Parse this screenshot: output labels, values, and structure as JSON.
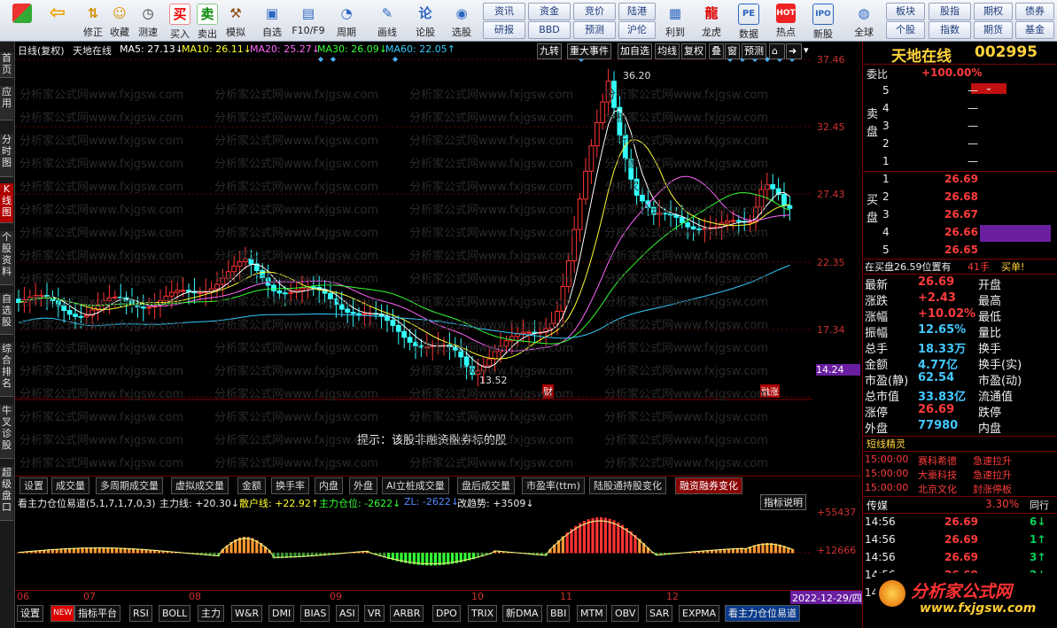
{
  "toolbar": {
    "buttons": [
      {
        "name": "home",
        "label": ""
      },
      {
        "name": "back",
        "label": ""
      },
      {
        "name": "modify",
        "label": "修正"
      },
      {
        "name": "favorite",
        "label": "收藏"
      },
      {
        "name": "speedtest",
        "label": "测速"
      },
      {
        "name": "buy",
        "label": "买入"
      },
      {
        "name": "sell",
        "label": "卖出"
      },
      {
        "name": "simulate",
        "label": "模拟"
      },
      {
        "name": "self-select",
        "label": "自选"
      },
      {
        "name": "f10",
        "label": "F10/F9"
      },
      {
        "name": "cycle",
        "label": "周期"
      },
      {
        "name": "draw",
        "label": "画线"
      },
      {
        "name": "stock-eval",
        "label": "论股"
      },
      {
        "name": "pick",
        "label": "选股"
      },
      {
        "name": "calendar",
        "label": "利到"
      },
      {
        "name": "dragon",
        "label": "龙虎"
      },
      {
        "name": "data",
        "label": "数据"
      },
      {
        "name": "hot",
        "label": "热点"
      },
      {
        "name": "newstock",
        "label": "新股"
      },
      {
        "name": "global",
        "label": "全球"
      }
    ],
    "quick": [
      "资讯",
      "资金",
      "竞价",
      "陆港",
      "研报",
      "BBD",
      "预测",
      "沪伦"
    ],
    "right_quick": [
      "板块",
      "股指",
      "期权",
      "债券",
      "个股",
      "指数",
      "期货",
      "基金"
    ]
  },
  "left_tabs": [
    "首页",
    "应用",
    "分时图",
    "K线图",
    "个股资料",
    "自选股",
    "综合排名",
    "牛叉诊股",
    "超级盘口"
  ],
  "chart": {
    "header": {
      "period": "日线(复权)",
      "stock": "天地在线",
      "ma5": "MA5: 27.13↓",
      "ma10": "MA10: 26.11↓",
      "ma20": "MA20: 25.27↓",
      "ma30": "MA30: 26.09↓",
      "ma60": "MA60: 22.05↑"
    },
    "top_buttons": [
      "九转",
      "重大事件",
      "加自选",
      "均线",
      "复权",
      "叠",
      "窗",
      "预测"
    ],
    "price_levels": [
      "37.46",
      "32.45",
      "27.43",
      "22.35",
      "17.34",
      "14.24"
    ],
    "high_label": "36.20",
    "low_label": "13.52",
    "marker_cai": "财",
    "marker_rong": "融涨",
    "notice": "提示：该股非融资融券标的股",
    "colors": {
      "ma5": "#ffffff",
      "ma10": "#ffff33",
      "ma20": "#ff66ff",
      "ma30": "#33ff33",
      "ma60": "#33ccff",
      "up": "#ff3333",
      "down": "#33ffff"
    },
    "watermark": "分析家公式网www.fxjgsw.com"
  },
  "ind_tabs": [
    "设置",
    "成交量",
    "多周期成交量",
    "虚拟成交量",
    "金额",
    "换手率",
    "内盘",
    "外盘",
    "AI立桩成交量",
    "盘后成交量",
    "市盈率(ttm)",
    "陆股通持股变化",
    "融资融券变化"
  ],
  "indicator": {
    "title": "看主力仓位易道(5,1,7,1,7,0,3)",
    "zl": "主力线: +20.30↓",
    "sh": "散户线: +22.92↑",
    "cw": "主力仓位: -2622↓",
    "zlv": "ZL: -2622↓",
    "trend": "改趋势: +3509↓",
    "help": "指标说明",
    "scale_top": "+55437",
    "scale_mid": "+12666"
  },
  "date_axis": {
    "months": [
      "06",
      "07",
      "08",
      "09",
      "10",
      "11",
      "12"
    ],
    "current_date": "2022-12-29/四"
  },
  "bottom_tabs": [
    "设置",
    "NEW",
    "指标平台",
    "RSI",
    "BOLL",
    "主力",
    "W&R",
    "DMI",
    "BIAS",
    "ASI",
    "VR",
    "ARBR",
    "DPO",
    "TRIX",
    "新DMA",
    "BBI",
    "MTM",
    "OBV",
    "SAR",
    "EXPMA",
    "看主力仓位易道"
  ],
  "quote": {
    "title": "天地在线",
    "code": "002995",
    "weibi_label": "委比",
    "weibi": "+100.00%",
    "sell_label": "卖盘",
    "buy_label": "买盘",
    "sells": [
      {
        "lvl": "5",
        "price": "—",
        "vol": ""
      },
      {
        "lvl": "4",
        "price": "—",
        "vol": ""
      },
      {
        "lvl": "3",
        "price": "—",
        "vol": ""
      },
      {
        "lvl": "2",
        "price": "—",
        "vol": ""
      },
      {
        "lvl": "1",
        "price": "—",
        "vol": ""
      }
    ],
    "buys": [
      {
        "lvl": "1",
        "price": "26.69",
        "vol": ""
      },
      {
        "lvl": "2",
        "price": "26.68",
        "vol": ""
      },
      {
        "lvl": "3",
        "price": "26.67",
        "vol": ""
      },
      {
        "lvl": "4",
        "price": "26.66",
        "vol": ""
      },
      {
        "lvl": "5",
        "price": "26.65",
        "vol": ""
      }
    ],
    "bidline": "在买盘26.59位置有",
    "bidvol": "41手",
    "bidtag": "买单!",
    "stats": [
      [
        "最新",
        "26.69",
        "开盘",
        ""
      ],
      [
        "涨跌",
        "+2.43",
        "最高",
        ""
      ],
      [
        "涨幅",
        "+10.02%",
        "最低",
        ""
      ],
      [
        "振幅",
        "12.65%",
        "量比",
        ""
      ],
      [
        "总手",
        "18.33万",
        "换手",
        ""
      ],
      [
        "金额",
        "4.77亿",
        "换手(实)",
        ""
      ],
      [
        "市盈(静)",
        "62.54",
        "市盈(动)",
        ""
      ],
      [
        "总市值",
        "33.83亿",
        "流通值",
        ""
      ],
      [
        "涨停",
        "26.69",
        "跌停",
        ""
      ],
      [
        "外盘",
        "77980",
        "内盘",
        ""
      ]
    ],
    "sprite_title": "短线精灵",
    "sprites": [
      {
        "time": "15:00:00",
        "name": "赛科希德",
        "event": "急速拉升"
      },
      {
        "time": "15:00:00",
        "name": "大豪科技",
        "event": "急速拉升"
      },
      {
        "time": "15:00:00",
        "name": "北京文化",
        "event": "封涨停板"
      }
    ],
    "sector": "传媒",
    "sector_pct": "3.30%",
    "sector_tab": "同行",
    "ticks": [
      {
        "time": "14:56",
        "price": "26.69",
        "vol": "6↓"
      },
      {
        "time": "14:56",
        "price": "26.69",
        "vol": "1↑"
      },
      {
        "time": "14:56",
        "price": "26.69",
        "vol": "3↑"
      },
      {
        "time": "14:56",
        "price": "26.69",
        "vol": "2↓"
      },
      {
        "time": "14:56",
        "price": "26.69",
        "vol": ""
      }
    ],
    "logo": "分析家公式网",
    "logo_url": "www.fxjgsw.com"
  }
}
